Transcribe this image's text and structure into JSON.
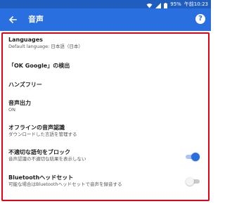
{
  "status_bar": {
    "battery": "95%",
    "time": "午前10:23",
    "icons": [
      "wifi-icon",
      "signal-icon",
      "battery-icon"
    ]
  },
  "toolbar": {
    "title": "音声",
    "back_icon": "arrow-left-icon",
    "help_icon": "help-icon",
    "help_glyph": "?"
  },
  "colors": {
    "status_bar": "#1f5dbf",
    "toolbar": "#2a6fe0",
    "highlight": "#e50019",
    "toggle_on": "#2a6fe0"
  },
  "settings": {
    "languages": {
      "title": "Languages",
      "summary": "Default language: 日本語（日本）"
    },
    "ok_google": {
      "title": "「OK Google」の検出"
    },
    "hands_free": {
      "title": "ハンズフリー"
    },
    "speech_output": {
      "title": "音声出力",
      "summary": "ON"
    },
    "offline": {
      "title": "オフラインの音声認識",
      "summary": "ダウンロードした言語を管理する"
    },
    "block_offensive": {
      "title": "不適切な語句をブロック",
      "summary": "音声認識の不適切な結果を表示しない",
      "enabled": true
    },
    "bluetooth": {
      "title": "Bluetoothヘッドセット",
      "summary": "可能な場合はBluetoothヘッドセットで音声を録音する",
      "enabled": false
    }
  }
}
